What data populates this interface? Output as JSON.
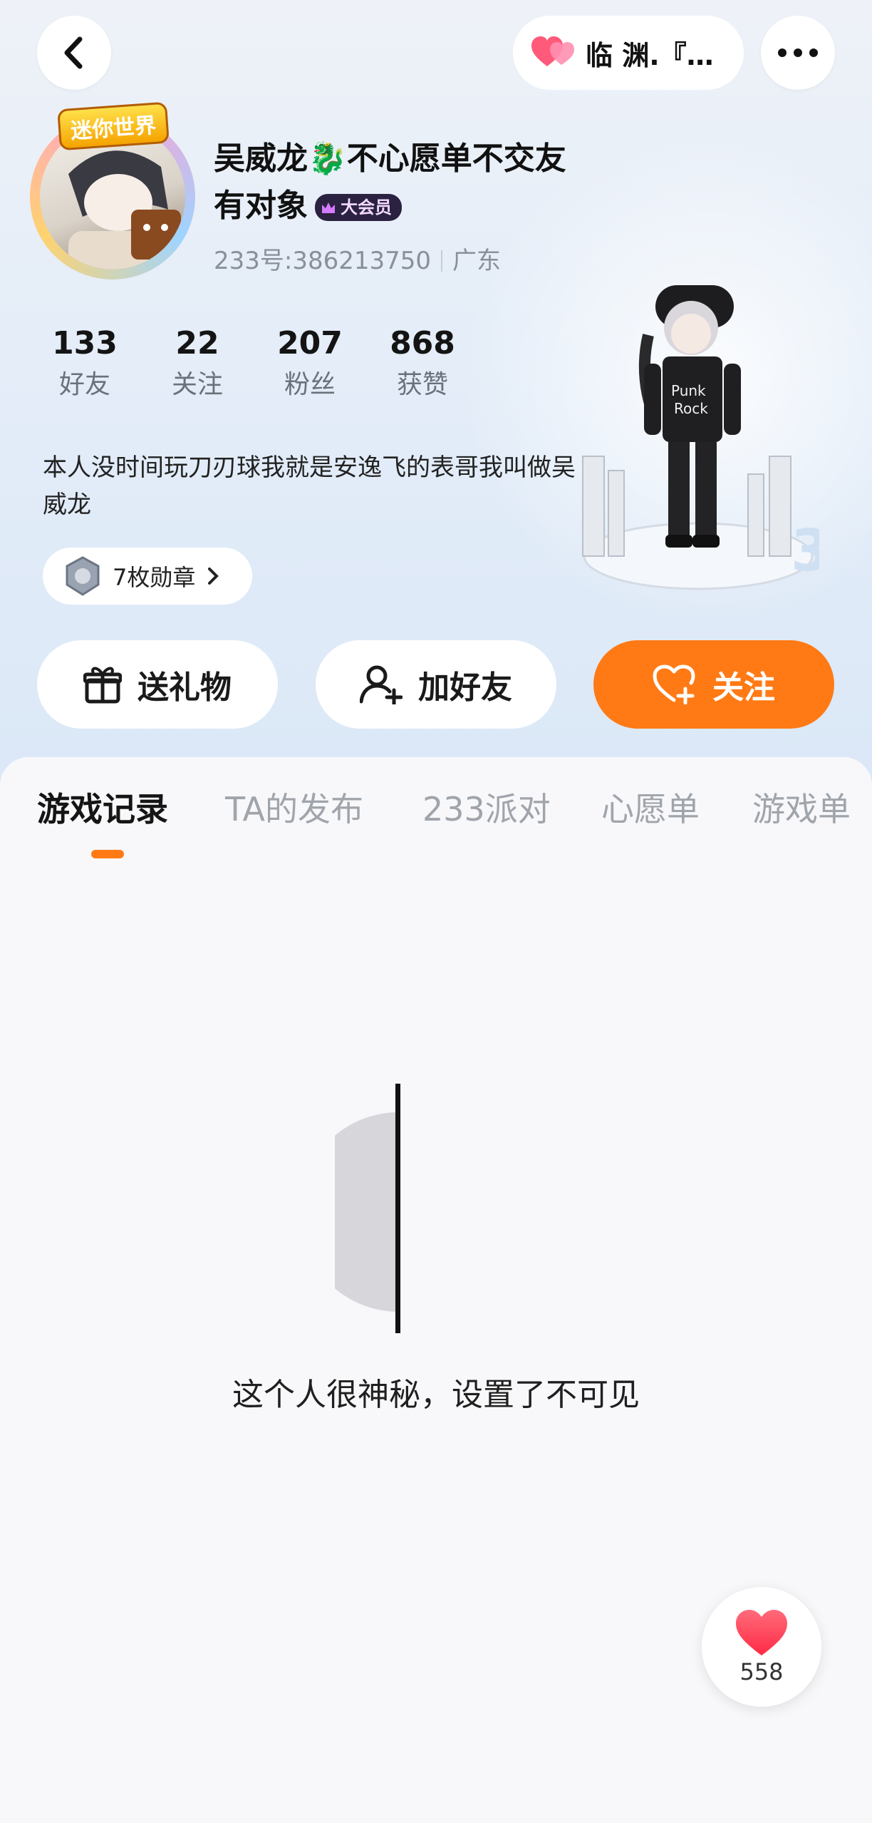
{
  "header": {
    "mutual_friend_label": "临 渊.『…"
  },
  "profile": {
    "avatar_logo_text": "迷你世界",
    "name": "吴威龙🐉不心愿单不交友有对象",
    "vip_badge": "大会员",
    "id_text": "233号:386213750",
    "region": "广东",
    "bio": "本人没时间玩刀刃球我就是安逸飞的表哥我叫做吴威龙",
    "medal_label": "7枚勋章"
  },
  "stats": [
    {
      "value": "133",
      "label": "好友"
    },
    {
      "value": "22",
      "label": "关注"
    },
    {
      "value": "207",
      "label": "粉丝"
    },
    {
      "value": "868",
      "label": "获赞"
    }
  ],
  "actions": {
    "gift": "送礼物",
    "add_friend": "加好友",
    "follow": "关注"
  },
  "tabs": [
    "游戏记录",
    "TA的发布",
    "233派对",
    "心愿单",
    "游戏单"
  ],
  "active_tab": "游戏记录",
  "empty_state": "这个人很神秘，设置了不可见",
  "like": {
    "count": "558"
  },
  "colors": {
    "accent": "#ff7a15",
    "vip_badge_bg": "#2b2140",
    "like_red": "#ff3d55"
  },
  "icons": [
    "back-icon",
    "heart-pair-icon",
    "more-icon",
    "gift-icon",
    "add-user-icon",
    "heart-plus-icon",
    "medal-icon",
    "chevron-right-icon",
    "heart-icon"
  ]
}
